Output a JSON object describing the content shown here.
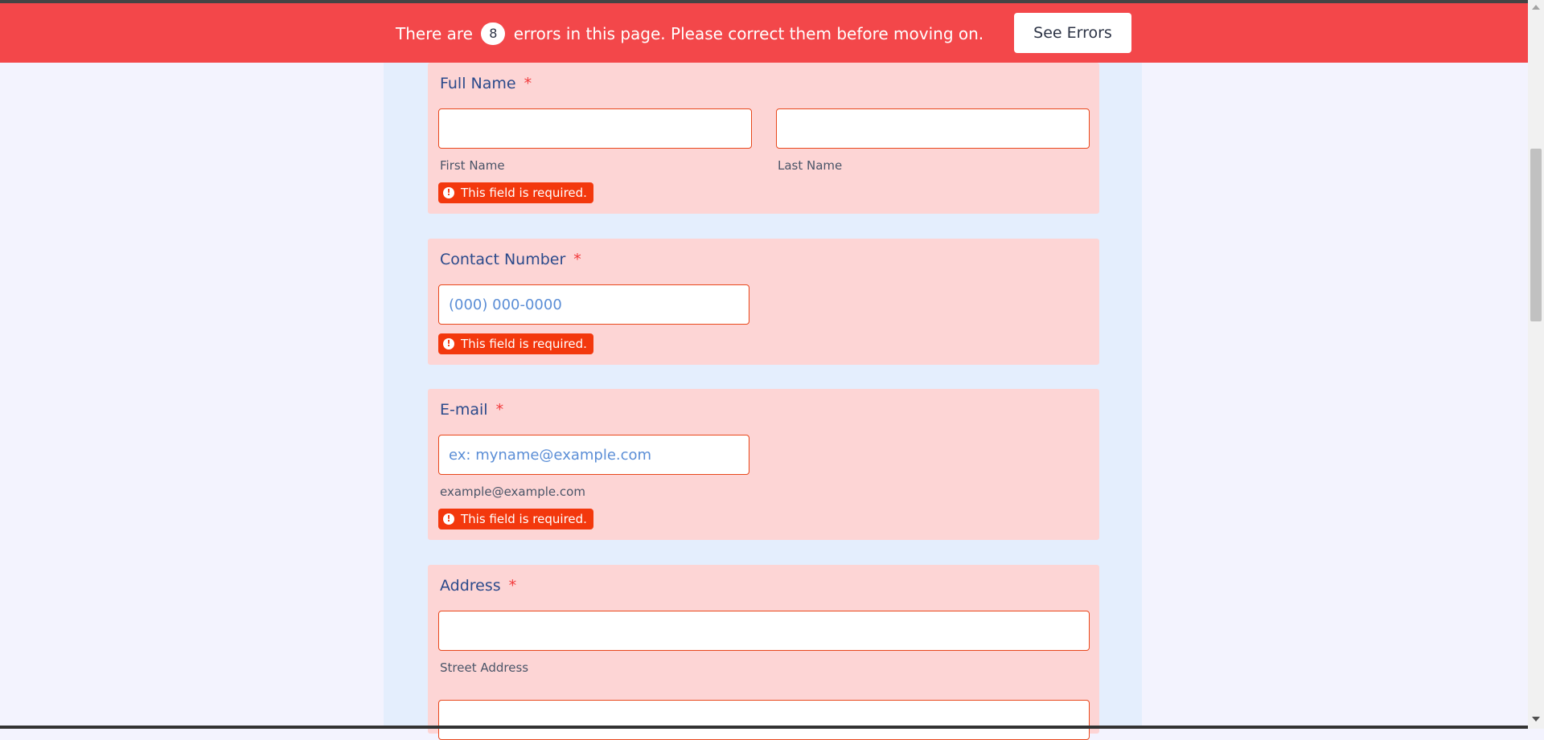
{
  "banner": {
    "message_before": "There are",
    "error_count": "8",
    "message_after": "errors in this page. Please correct them before moving on.",
    "button_label": "See Errors"
  },
  "full_name": {
    "label": "Full Name",
    "required_mark": "*",
    "first_sublabel": "First Name",
    "last_sublabel": "Last Name",
    "first_value": "",
    "last_value": "",
    "error": "This field is required."
  },
  "contact": {
    "label": "Contact Number",
    "required_mark": "*",
    "placeholder": "(000) 000-0000",
    "value": "",
    "error": "This field is required."
  },
  "email": {
    "label": "E-mail",
    "required_mark": "*",
    "placeholder": "ex: myname@example.com",
    "value": "",
    "sublabel": "example@example.com",
    "error": "This field is required."
  },
  "address": {
    "label": "Address",
    "required_mark": "*",
    "street_value": "",
    "street_sublabel": "Street Address",
    "line2_value": ""
  },
  "error_icon_glyph": "!",
  "colors": {
    "banner_bg": "#f3474a",
    "card_error_bg": "#fdd5d5",
    "error_badge": "#f3380d",
    "label": "#2b4a8b",
    "required": "#f23a3c"
  }
}
